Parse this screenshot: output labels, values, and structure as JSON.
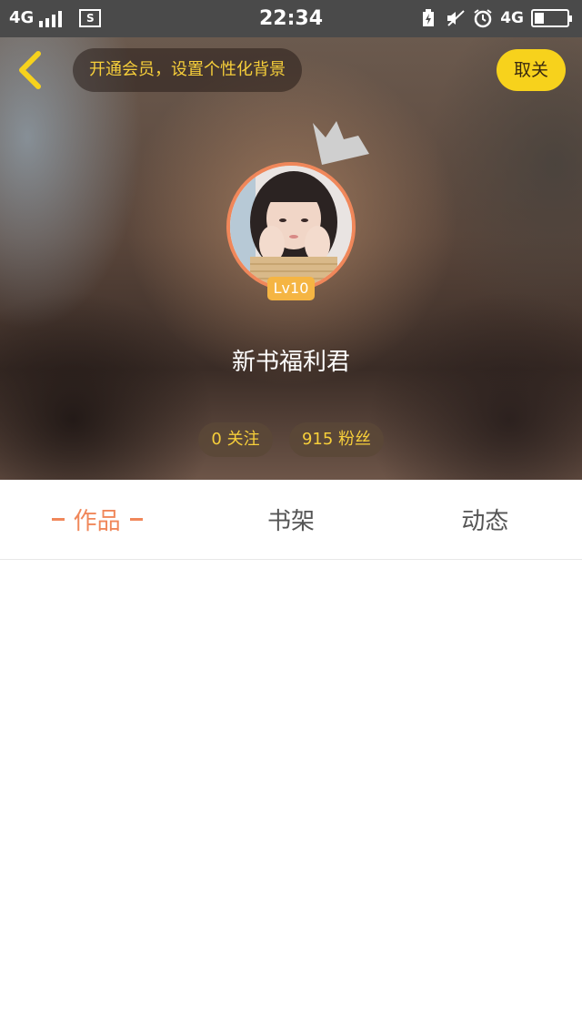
{
  "status_bar": {
    "network_left": "4G",
    "time": "22:34",
    "network_right": "4G",
    "battery_level": 0.3,
    "icons": [
      "signal-icon",
      "screenshot-icon",
      "charging-icon",
      "mute-icon",
      "alarm-icon",
      "battery-icon"
    ]
  },
  "header": {
    "back_icon": "chevron-left-icon",
    "vip_banner": "开通会员，设置个性化背景",
    "follow_label": "取关"
  },
  "profile": {
    "username": "新书福利君",
    "level": "Lv10",
    "following": "0 关注",
    "fans": "915 粉丝"
  },
  "tabs": [
    {
      "label": "作品",
      "active": true
    },
    {
      "label": "书架",
      "active": false
    },
    {
      "label": "动态",
      "active": false
    }
  ],
  "colors": {
    "accent": "#f0875a",
    "yellow": "#f7d21c",
    "gold_text": "#f7cf3a",
    "level_badge": "#f5b543"
  }
}
